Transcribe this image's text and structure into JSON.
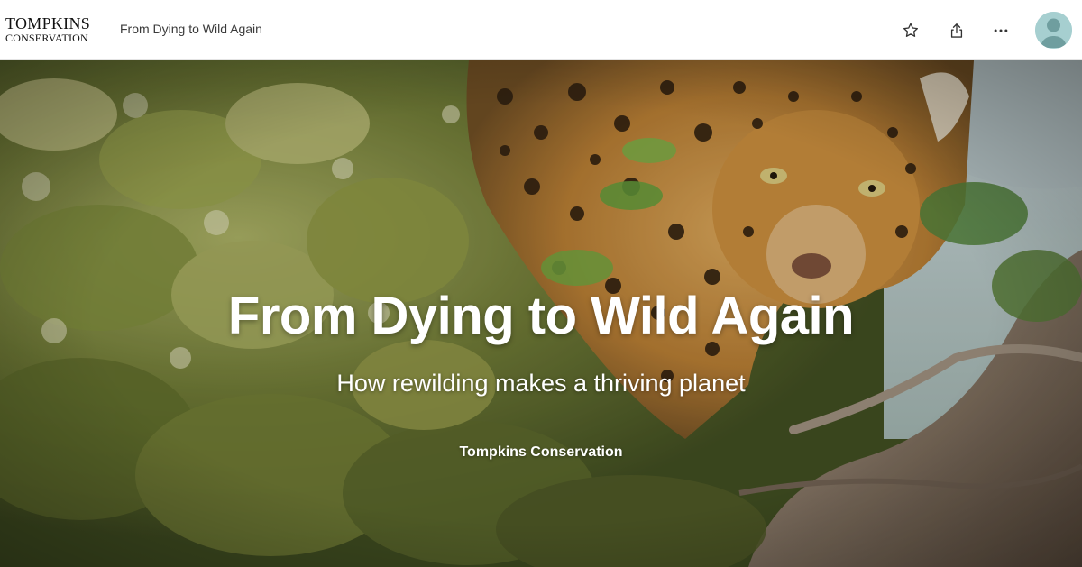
{
  "header": {
    "logo_line1": "TOMPKINS",
    "logo_line2": "CONSERVATION",
    "story_title": "From Dying to Wild Again",
    "icons": {
      "favorite": "star-icon",
      "share": "share-icon",
      "more": "more-options-icon",
      "avatar": "user-avatar-icon"
    }
  },
  "hero": {
    "title": "From Dying to Wild Again",
    "subtitle": "How rewilding makes a thriving planet",
    "byline": "Tompkins Conservation",
    "image": "jaguar-in-foliage-photo"
  },
  "colors": {
    "header_bg": "#ffffff",
    "hero_text": "#ffffff",
    "foliage": "#6f7a32",
    "jaguar": "#c48a3a",
    "branch": "#8a7664",
    "avatar_bg": "#a6cfd0"
  }
}
